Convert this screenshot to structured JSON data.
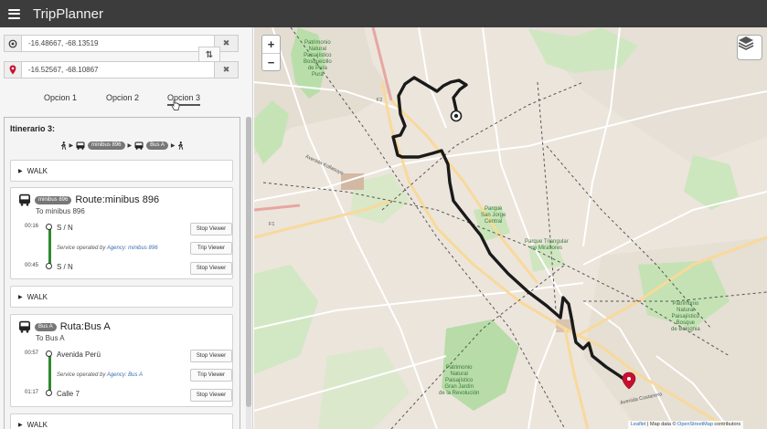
{
  "app": {
    "title": "TripPlanner"
  },
  "origin": {
    "value": "-16.48667, -68.13519"
  },
  "destination": {
    "value": "-16.52567, -68.10867"
  },
  "tabs": [
    {
      "label": "Opcion 1"
    },
    {
      "label": "Opcion 2"
    },
    {
      "label": "Opcion 3"
    }
  ],
  "itinerary": {
    "title": "Itinerario 3:",
    "summary_badges": [
      "minibus 896",
      "Bus A"
    ],
    "walk_label": "WALK",
    "legs": [
      {
        "badge": "minibus 896",
        "route": "Route:minibus 896",
        "to": "To minibus 896",
        "start_time": "00:16",
        "start_stop": "S / N",
        "end_time": "00:45",
        "end_stop": "S / N",
        "service_prefix": "Service operated by",
        "agency": "Agency: minibus 896"
      },
      {
        "badge": "Bus A",
        "route": "Ruta:Bus A",
        "to": "To Bus A",
        "start_time": "00:57",
        "start_stop": "Avenida Perú",
        "end_time": "01:17",
        "end_stop": "Calle 7",
        "service_prefix": "Service operated by",
        "agency": "Agency: Bus A"
      }
    ],
    "stop_viewer_label": "Stop Viewer",
    "trip_viewer_label": "Trip Viewer"
  },
  "map": {
    "zoom_in": "+",
    "zoom_out": "−",
    "labels": {
      "park_north": "Patrimonio\nNatural\nPaisajístico\nBosquecillo\nde Pura\nPura",
      "park_south": "Patrimonio\nNatural\nPaisajístico\nGran Jardín\nde la Revolución",
      "park_east": "Patrimonio\nNatural\nPaisajístico\nBosque\nde Bolognia",
      "san_jorge": "Parque\nSan Jorge\nCentral",
      "triangular": "Parque Triangular\nde Miraflores",
      "f2": "F2",
      "f1": "F1",
      "avenida_kollasuyo": "Avenida Kollasuyo",
      "avenida_costanera": "Avenida Costanera"
    },
    "attribution": {
      "leaflet": "Leaflet",
      "sep": " | Map data © ",
      "osm": "OpenStreetMap",
      "rest": " contributors"
    }
  },
  "colors": {
    "topbar": "#3c3c3c",
    "route_line": "#1a1a1a",
    "stop_line": "#2f8a2f",
    "destination_marker": "#c8102e",
    "agency_link": "#3a6fb0"
  }
}
